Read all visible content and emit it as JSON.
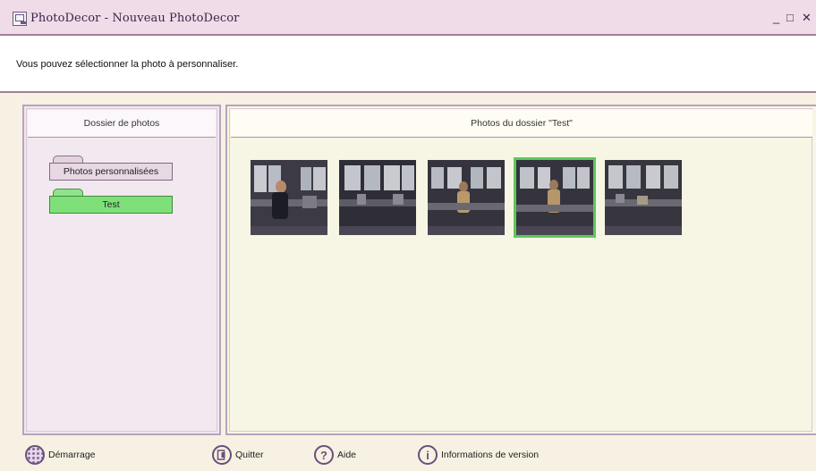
{
  "window": {
    "title": "PhotoDecor - Nouveau PhotoDecor",
    "minimize_glyph": "_",
    "maximize_glyph": "□",
    "close_glyph": "✕"
  },
  "instruction": "Vous pouvez sélectionner la photo à personnaliser.",
  "left_panel": {
    "title": "Dossier de photos",
    "folders": [
      {
        "label": "Photos personnalisées",
        "selected": false
      },
      {
        "label": "Test",
        "selected": true
      }
    ]
  },
  "right_panel": {
    "title": "Photos du dossier \"Test\"",
    "selected_index": 3,
    "thumbnails": [
      {
        "icon": "office-photo-thumbnail"
      },
      {
        "icon": "office-photo-thumbnail"
      },
      {
        "icon": "office-photo-thumbnail"
      },
      {
        "icon": "office-photo-thumbnail"
      },
      {
        "icon": "office-photo-thumbnail"
      }
    ]
  },
  "footer": {
    "start": {
      "label": "Démarrage",
      "icon": "grid-circle-icon"
    },
    "quit": {
      "label": "Quitter",
      "icon": "door-exit-icon"
    },
    "help": {
      "label": "Aide",
      "icon": "question-mark-icon",
      "glyph": "?"
    },
    "version": {
      "label": "Informations de version",
      "icon": "info-icon",
      "glyph": "i"
    }
  },
  "colors": {
    "accent_border": "#a47f98",
    "selected_green": "#7fe07a",
    "left_panel_bg": "#f2e8ef",
    "right_panel_bg": "#f7f6e4"
  }
}
